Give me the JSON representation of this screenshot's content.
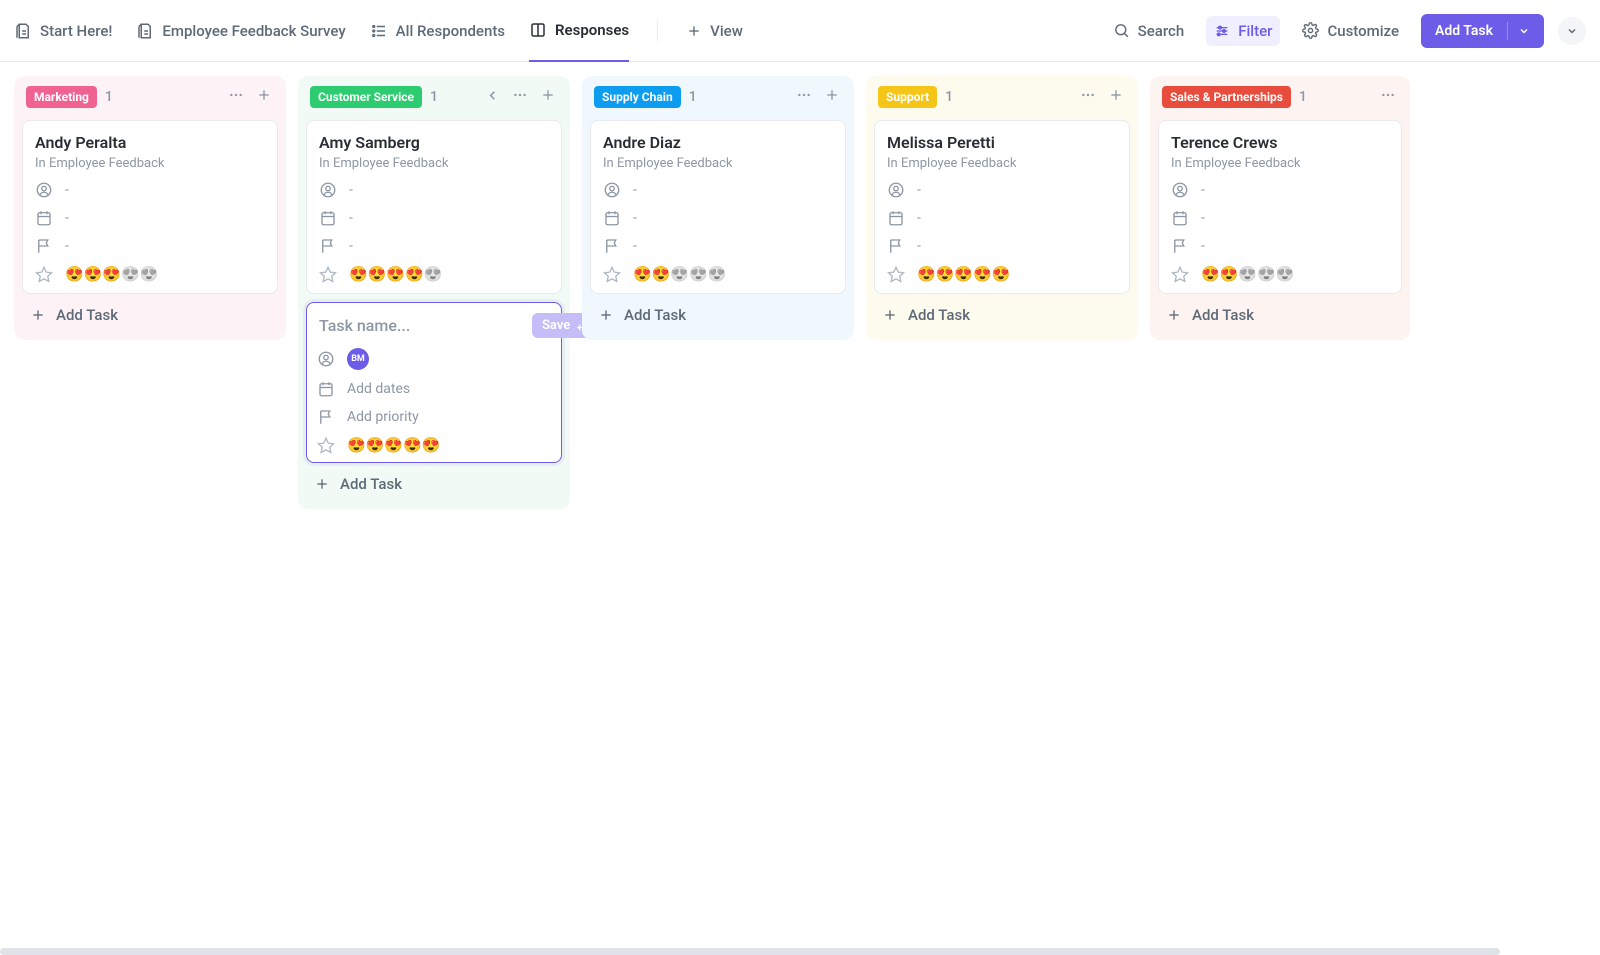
{
  "tabs": [
    {
      "label": "Start Here!",
      "icon": "doc"
    },
    {
      "label": "Employee Feedback Survey",
      "icon": "doc"
    },
    {
      "label": "All Respondents",
      "icon": "list"
    },
    {
      "label": "Responses",
      "icon": "board",
      "active": true
    }
  ],
  "add_view": "View",
  "toolbar": {
    "search": "Search",
    "filter": "Filter",
    "customize": "Customize",
    "add_task": "Add Task"
  },
  "columns": [
    {
      "name": "Marketing",
      "count": "1",
      "pill_color": "#f06292",
      "bg": "#fdf3f6",
      "card": {
        "title": "Andy Peralta",
        "sub": "In Employee Feedback",
        "rating": 3
      },
      "add_label": "Add Task",
      "focused": false
    },
    {
      "name": "Customer Service",
      "count": "1",
      "pill_color": "#2ecc71",
      "bg": "#f1faf5",
      "card": {
        "title": "Amy Samberg",
        "sub": "In Employee Feedback",
        "rating": 4
      },
      "add_label": "Add Task",
      "focused": true,
      "new_task": {
        "placeholder": "Task name...",
        "save": "Save",
        "assignee_initials": "BM",
        "dates": "Add dates",
        "priority": "Add priority"
      }
    },
    {
      "name": "Supply Chain",
      "count": "1",
      "pill_color": "#0c9cf0",
      "bg": "#f0f8fe",
      "card": {
        "title": "Andre Diaz",
        "sub": "In Employee Feedback",
        "rating": 2
      },
      "add_label": "Add Task",
      "focused": false
    },
    {
      "name": "Support",
      "count": "1",
      "pill_color": "#f5c518",
      "bg": "#fdfaee",
      "card": {
        "title": "Melissa Peretti",
        "sub": "In Employee Feedback",
        "rating": 5
      },
      "add_label": "Add Task",
      "focused": false
    },
    {
      "name": "Sales & Partnerships",
      "count": "1",
      "pill_color": "#e84c3d",
      "bg": "#fdf3f1",
      "card": {
        "title": "Terence Crews",
        "sub": "In Employee Feedback",
        "rating": 2
      },
      "add_label": "Add Task",
      "focused": false,
      "last": true
    }
  ]
}
